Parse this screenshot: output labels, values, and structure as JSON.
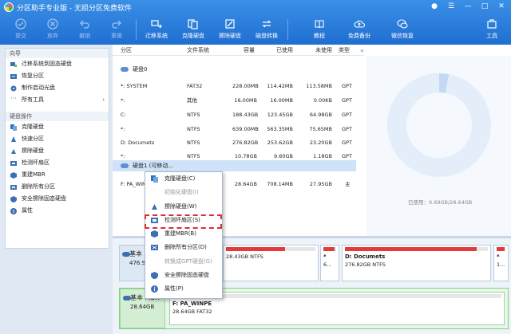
{
  "app": {
    "title": "分区助手专业版 - 无损分区免费软件"
  },
  "toolbar": {
    "items": [
      {
        "label": "提交",
        "icon": "check-icon",
        "enabled": false
      },
      {
        "label": "放弃",
        "icon": "discard-icon",
        "enabled": false
      },
      {
        "label": "撤销",
        "icon": "undo-icon",
        "enabled": false
      },
      {
        "label": "重做",
        "icon": "redo-icon",
        "enabled": false
      },
      {
        "label": "迁移系统",
        "icon": "migrate-icon",
        "enabled": true
      },
      {
        "label": "克隆硬盘",
        "icon": "clone-icon",
        "enabled": true
      },
      {
        "label": "擦除硬盘",
        "icon": "wipe-icon",
        "enabled": true
      },
      {
        "label": "磁盘转换",
        "icon": "convert-icon",
        "enabled": true
      },
      {
        "label": "教程",
        "icon": "tutorial-icon",
        "enabled": true
      },
      {
        "label": "免费备份",
        "icon": "backup-icon",
        "enabled": true
      },
      {
        "label": "微信恢复",
        "icon": "wechat-icon",
        "enabled": true
      },
      {
        "label": "工具",
        "icon": "tools-icon",
        "enabled": true
      }
    ]
  },
  "sidebar": {
    "wizard_title": "向导",
    "wizard_items": [
      {
        "label": "迁移系统到固态硬盘",
        "icon": "migrate-icon"
      },
      {
        "label": "恢复分区",
        "icon": "restore-icon"
      },
      {
        "label": "制作启动光盘",
        "icon": "disc-icon"
      },
      {
        "label": "所有工具",
        "icon": "dots-icon",
        "arrow": "›"
      }
    ],
    "disk_ops_title": "硬盘操作",
    "disk_ops_items": [
      {
        "label": "克隆硬盘",
        "icon": "clone-icon"
      },
      {
        "label": "快速分区",
        "icon": "quick-partition-icon"
      },
      {
        "label": "擦除硬盘",
        "icon": "wipe-icon"
      },
      {
        "label": "检测坏扇区",
        "icon": "check-sector-icon"
      },
      {
        "label": "重建MBR",
        "icon": "mbr-icon"
      },
      {
        "label": "删除所有分区",
        "icon": "delete-icon"
      },
      {
        "label": "安全擦除固态硬盘",
        "icon": "secure-erase-icon"
      },
      {
        "label": "属性",
        "icon": "info-icon"
      }
    ]
  },
  "table": {
    "headers": {
      "partition": "分区",
      "fs": "文件系统",
      "capacity": "容量",
      "used": "已使用",
      "unused": "未使用",
      "type": "类型"
    },
    "disk0": {
      "label": "硬盘0"
    },
    "rows": [
      {
        "name": "*: SYSTEM",
        "fs": "FAT32",
        "capacity": "228.00MB",
        "used": "114.42MB",
        "unused": "113.58MB",
        "type": "GPT"
      },
      {
        "name": "*:",
        "fs": "其他",
        "capacity": "16.00MB",
        "used": "16.00MB",
        "unused": "0.00KB",
        "type": "GPT"
      },
      {
        "name": "C:",
        "fs": "NTFS",
        "capacity": "188.43GB",
        "used": "123.45GB",
        "unused": "64.98GB",
        "type": "GPT"
      },
      {
        "name": "*:",
        "fs": "NTFS",
        "capacity": "639.00MB",
        "used": "563.35MB",
        "unused": "75.65MB",
        "type": "GPT"
      },
      {
        "name": "D: Documets",
        "fs": "NTFS",
        "capacity": "276.82GB",
        "used": "253.62GB",
        "unused": "23.20GB",
        "type": "GPT"
      },
      {
        "name": "*:",
        "fs": "NTFS",
        "capacity": "10.78GB",
        "used": "9.60GB",
        "unused": "1.18GB",
        "type": "GPT"
      }
    ],
    "disk1": {
      "label": "硬盘1 (可移动..."
    },
    "disk1_rows": [
      {
        "name": "F: PA_WINP",
        "fs": "",
        "capacity": "28.64GB",
        "used": "708.14MB",
        "unused": "27.95GB",
        "type": "主"
      }
    ]
  },
  "usage_panel": {
    "text": "已使用：0.69GB/28.64GB",
    "used_fraction": 0.024
  },
  "diskmap": {
    "disk0": {
      "name": "基本",
      "size": "476.9"
    },
    "disk0_parts": [
      {
        "name": "",
        "size": "28.43GB NTFS",
        "fill": 0.66
      },
      {
        "name": "*",
        "size": "6...",
        "fill": 0.88
      },
      {
        "name": "D: Documets",
        "size": "276.82GB NTFS",
        "fill": 0.92
      },
      {
        "name": "*",
        "size": "1...",
        "fill": 0.89
      }
    ],
    "disk1": {
      "name": "基本 MBR",
      "size": "28.64GB"
    },
    "disk1_part": {
      "name": "F: PA_WINPE",
      "size": "28.64GB FAT32",
      "fill": 0.024
    }
  },
  "context_menu": {
    "items": [
      {
        "label": "克隆硬盘(C)",
        "icon": "clone-icon",
        "enabled": true
      },
      {
        "label": "初始化硬盘(I)",
        "icon": "",
        "enabled": false
      },
      {
        "label": "擦除硬盘(W)",
        "icon": "wipe-icon",
        "enabled": true
      },
      {
        "label": "检测坏扇区(S)",
        "icon": "check-sector-icon",
        "enabled": true,
        "highlighted": true
      },
      {
        "label": "重建MBR(B)",
        "icon": "mbr-icon",
        "enabled": true
      },
      {
        "label": "删除所有分区(D)",
        "icon": "delete-icon",
        "enabled": true
      },
      {
        "label": "转换成GPT硬盘(G)",
        "icon": "",
        "enabled": false
      },
      {
        "label": "安全擦除固态硬盘",
        "icon": "secure-erase-icon",
        "enabled": true
      },
      {
        "label": "属性(P)",
        "icon": "info-icon",
        "enabled": true
      }
    ]
  },
  "colors": {
    "toolbar_blue": "#1f6fd1",
    "usage_red": "#e23b3b",
    "highlight_red": "#d63030",
    "selected_row": "#cfe2f8"
  }
}
